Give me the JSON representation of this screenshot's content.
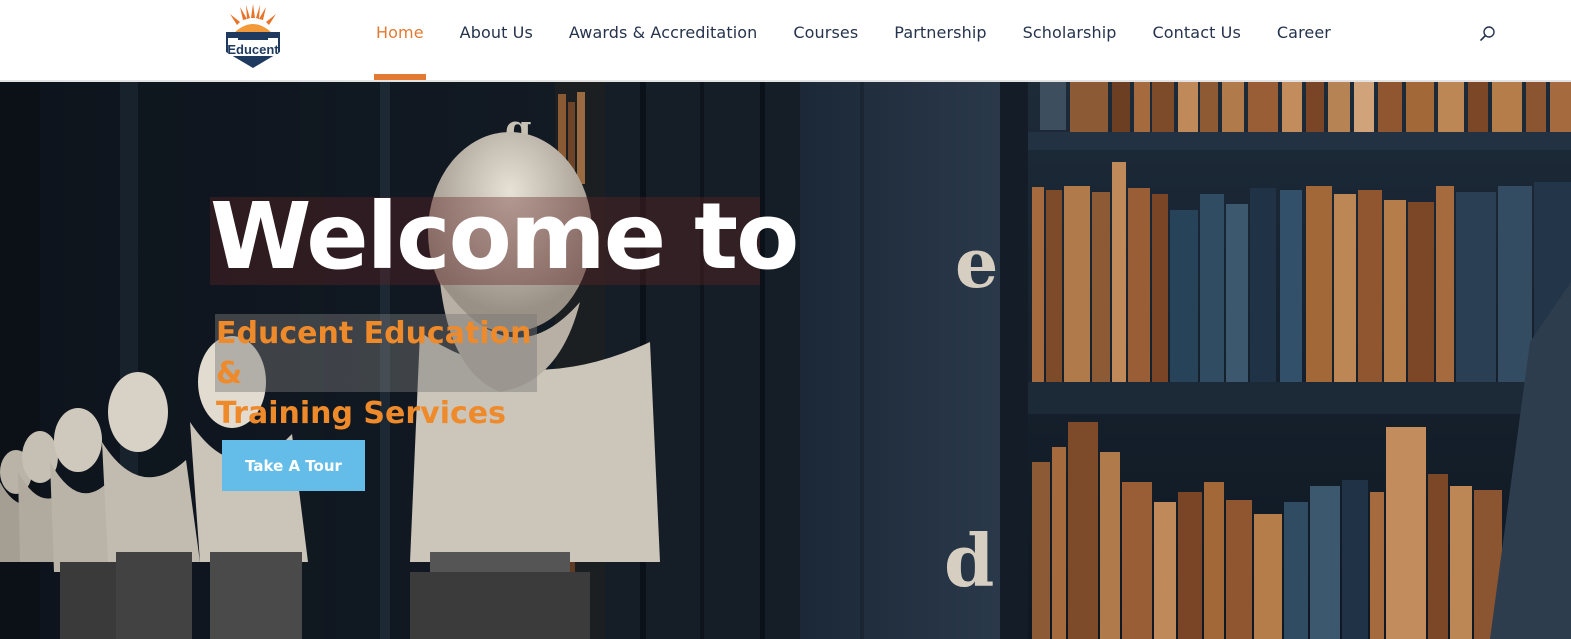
{
  "logo": {
    "text": "Educent",
    "icon": "educent-logo-sunburst-icon"
  },
  "nav": {
    "items": [
      {
        "label": "Home",
        "active": true
      },
      {
        "label": "About Us",
        "active": false
      },
      {
        "label": "Awards & Accreditation",
        "active": false
      },
      {
        "label": "Courses",
        "active": false
      },
      {
        "label": "Partnership",
        "active": false
      },
      {
        "label": "Scholarship",
        "active": false
      },
      {
        "label": "Contact Us",
        "active": false
      },
      {
        "label": "Career",
        "active": false
      }
    ],
    "search_icon": "search-icon"
  },
  "hero": {
    "title": "Welcome to",
    "subtitle_line1": "Educent Education &",
    "subtitle_line2": "Training Services",
    "cta_label": "Take A Tour",
    "background": "library-busts-bookshelves-image",
    "letters": [
      "g",
      "e",
      "d"
    ]
  },
  "colors": {
    "accent": "#e37a34",
    "nav_text": "#25334d",
    "subtitle": "#ef8a2b",
    "cta": "#64bde8"
  }
}
